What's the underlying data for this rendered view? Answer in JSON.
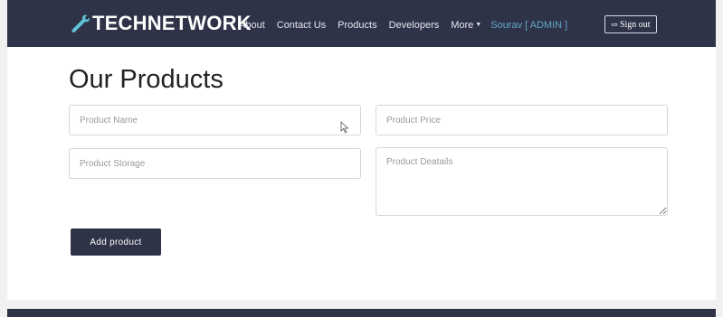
{
  "navbar": {
    "brand": "TECHNETWORK",
    "brand_icon": "wrench-icon",
    "links": [
      "About",
      "Contact Us",
      "Products",
      "Developers"
    ],
    "more_label": "More",
    "user_label": "Sourav [ ADMIN ]",
    "signout_label": "Sign out",
    "signout_icon": "sign-out-icon"
  },
  "page": {
    "title": "Our Products"
  },
  "form": {
    "product_name_placeholder": "Product Name",
    "product_price_placeholder": "Product Price",
    "product_storage_placeholder": "Product Storage",
    "product_details_placeholder": "Product Deatails",
    "submit_label": "Add product"
  },
  "colors": {
    "navbar": "#2f3348",
    "accent_user": "#5fa8c8",
    "button": "#2f3348",
    "background": "#f1f1f1"
  }
}
